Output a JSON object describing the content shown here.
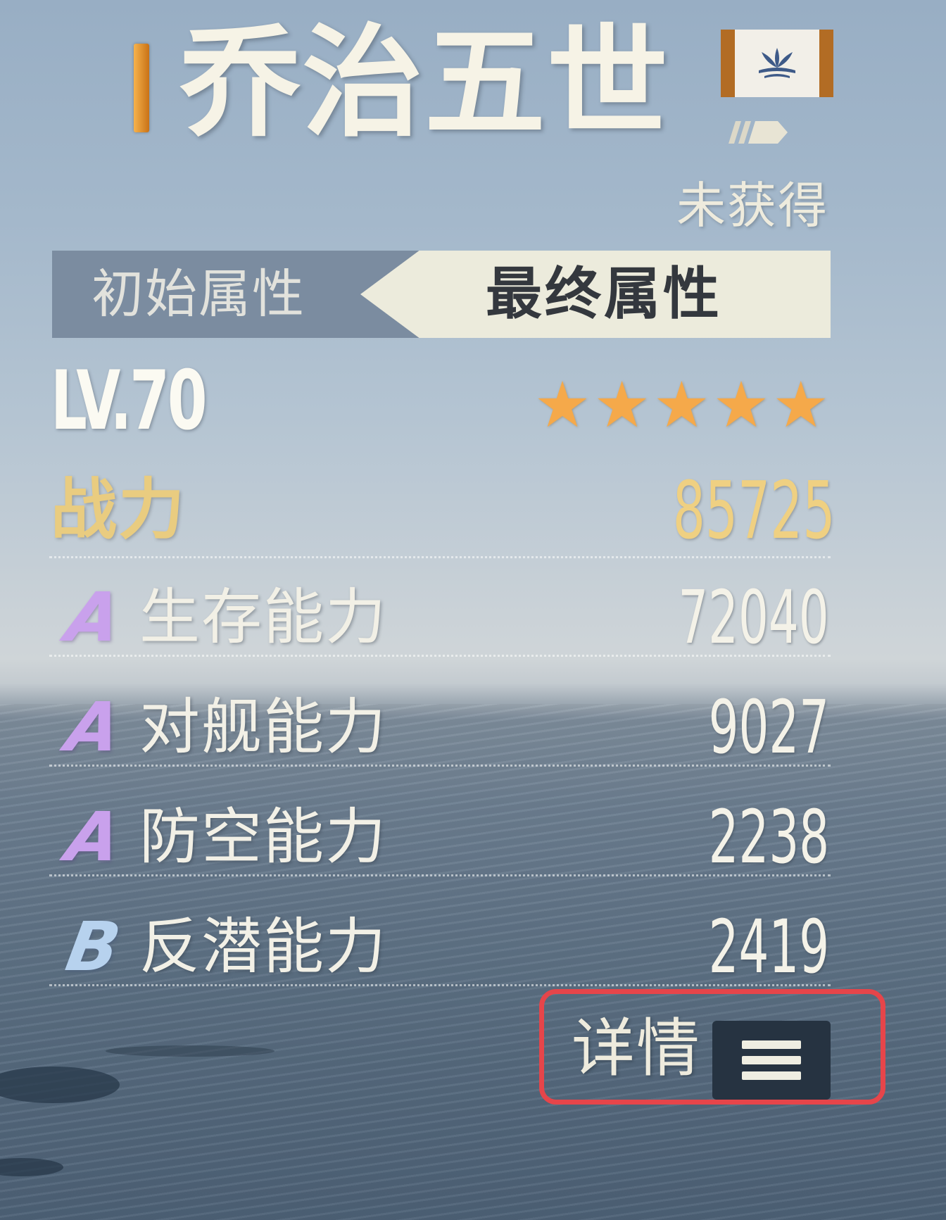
{
  "ship": {
    "name": "乔治五世",
    "status": "未获得"
  },
  "tabs": {
    "initial_label": "初始属性",
    "final_label": "最终属性",
    "active": "final"
  },
  "level": {
    "text": "LV.70"
  },
  "rarity": {
    "stars_text": "★★★★★",
    "stars": 5,
    "color": "#f5a94a"
  },
  "power": {
    "label": "战力",
    "value": "85725",
    "color": "#efd082"
  },
  "stats": [
    {
      "grade": "A",
      "name": "生存能力",
      "value": "72040"
    },
    {
      "grade": "A",
      "name": "对舰能力",
      "value": "9027"
    },
    {
      "grade": "A",
      "name": "防空能力",
      "value": "2238"
    },
    {
      "grade": "B",
      "name": "反潜能力",
      "value": "2419"
    }
  ],
  "details": {
    "label": "详情",
    "icon": "menu-icon",
    "highlight_color": "#e6454a"
  },
  "flag": {
    "icon": "flag-emblem-icon"
  },
  "class_mark": {
    "icon": "ship-class-icon"
  }
}
